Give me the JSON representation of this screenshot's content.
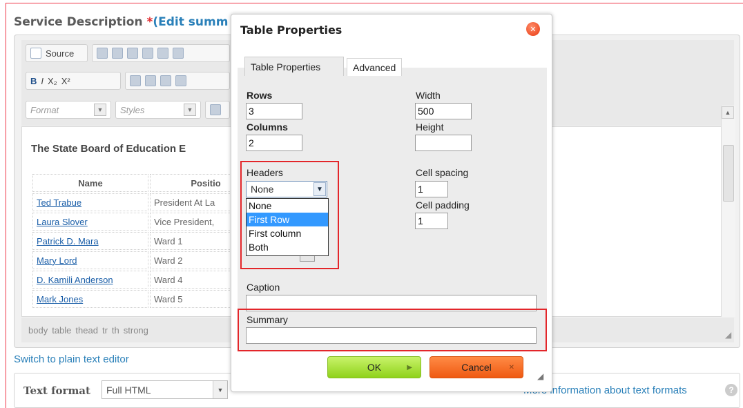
{
  "field": {
    "label": "Service Description ",
    "required_mark": "*",
    "edit_summary_link": "(Edit summ"
  },
  "toolbar": {
    "source_label": "Source",
    "bold_label": "B",
    "italic_label": "I",
    "subscript_label": "X₂",
    "superscript_label": "X²",
    "format_placeholder": "Format",
    "styles_placeholder": "Styles"
  },
  "editor": {
    "heading": "The State Board of Education E",
    "table_headers": [
      "Name",
      "Positio"
    ],
    "rows": [
      {
        "name": "Ted Trabue",
        "position": "President At La"
      },
      {
        "name": "Laura Slover",
        "position": "Vice President,"
      },
      {
        "name": "Patrick D. Mara",
        "position": "Ward 1"
      },
      {
        "name": "Mary Lord",
        "position": "Ward 2"
      },
      {
        "name": "D. Kamili Anderson",
        "position": "Ward 4"
      },
      {
        "name": "Mark Jones",
        "position": "Ward 5"
      }
    ],
    "statusbar": [
      "body",
      "table",
      "thead",
      "tr",
      "th",
      "strong"
    ]
  },
  "switch_link": "Switch to plain text editor",
  "text_format": {
    "label": "Text format",
    "selected": "Full HTML",
    "more_info": "More information about text formats",
    "help_glyph": "?"
  },
  "dialog": {
    "title": "Table Properties",
    "tabs": [
      "Table Properties",
      "Advanced"
    ],
    "rows_label": "Rows",
    "rows_value": "3",
    "columns_label": "Columns",
    "columns_value": "2",
    "width_label": "Width",
    "width_value": "500",
    "height_label": "Height",
    "height_value": "",
    "headers_label": "Headers",
    "headers_selected": "None",
    "headers_options": [
      "None",
      "First Row",
      "First column",
      "Both"
    ],
    "headers_highlighted": "First Row",
    "cell_spacing_label": "Cell spacing",
    "cell_spacing_value": "1",
    "cell_padding_label": "Cell padding",
    "cell_padding_value": "1",
    "caption_label": "Caption",
    "caption_value": "",
    "summary_label": "Summary",
    "summary_value": "",
    "ok_label": "OK",
    "cancel_label": "Cancel"
  },
  "colors": {
    "highlight_border": "#e3262a",
    "link": "#2a80b9",
    "ok_green": "#8fd21b",
    "cancel_orange": "#ef5a12",
    "selected_option": "#3399ff"
  }
}
